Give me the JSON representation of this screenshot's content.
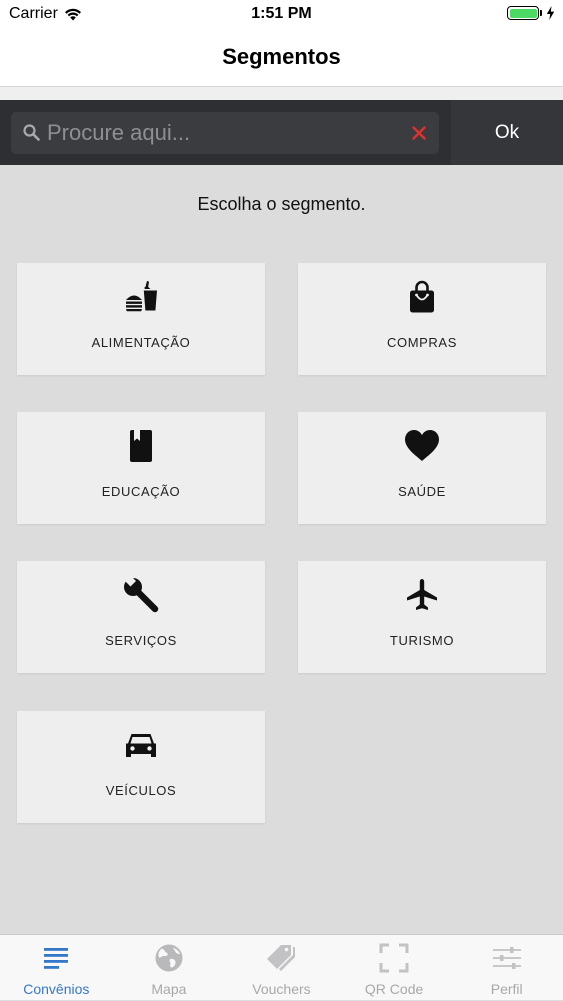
{
  "status_bar": {
    "carrier": "Carrier",
    "time": "1:51 PM"
  },
  "nav": {
    "title": "Segmentos"
  },
  "search": {
    "placeholder": "Procure aqui...",
    "value": "",
    "ok_label": "Ok"
  },
  "instruction": "Escolha o segmento.",
  "segments": [
    {
      "label": "ALIMENTAÇÃO",
      "icon": "food-drink-icon"
    },
    {
      "label": "COMPRAS",
      "icon": "shopping-bag-icon"
    },
    {
      "label": "EDUCAÇÃO",
      "icon": "book-icon"
    },
    {
      "label": "SAÚDE",
      "icon": "heart-icon"
    },
    {
      "label": "SERVIÇOS",
      "icon": "wrench-icon"
    },
    {
      "label": "TURISMO",
      "icon": "airplane-icon"
    },
    {
      "label": "VEÍCULOS",
      "icon": "car-icon"
    }
  ],
  "tabs": [
    {
      "label": "Convênios",
      "icon": "list-icon",
      "active": true
    },
    {
      "label": "Mapa",
      "icon": "globe-icon",
      "active": false
    },
    {
      "label": "Vouchers",
      "icon": "tag-icon",
      "active": false
    },
    {
      "label": "QR Code",
      "icon": "qr-scan-icon",
      "active": false
    },
    {
      "label": "Perfil",
      "icon": "sliders-icon",
      "active": false
    }
  ],
  "colors": {
    "accent": "#3478c8",
    "search_bar_bg": "#2e2f33",
    "clear_icon": "#e0312f",
    "battery": "#4cd964",
    "card_bg": "#eeeeef",
    "content_bg": "#dcdcdd"
  }
}
